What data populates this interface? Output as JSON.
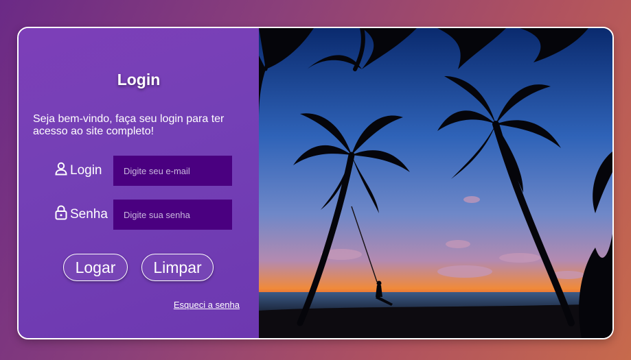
{
  "login_panel": {
    "title": "Login",
    "welcome": "Seja bem-vindo, faça seu login para ter acesso ao site completo!",
    "login_label": "Login",
    "login_placeholder": "Digite seu e-mail",
    "password_label": "Senha",
    "password_placeholder": "Digite sua senha",
    "submit_button": "Logar",
    "clear_button": "Limpar",
    "forgot_link": "Esqueci a senha"
  },
  "colors": {
    "panel_purple": "#7440b6",
    "field_purple": "#4a0080",
    "border": "#ffffff"
  },
  "icons": {
    "login": "user-icon",
    "password": "lock-icon"
  }
}
